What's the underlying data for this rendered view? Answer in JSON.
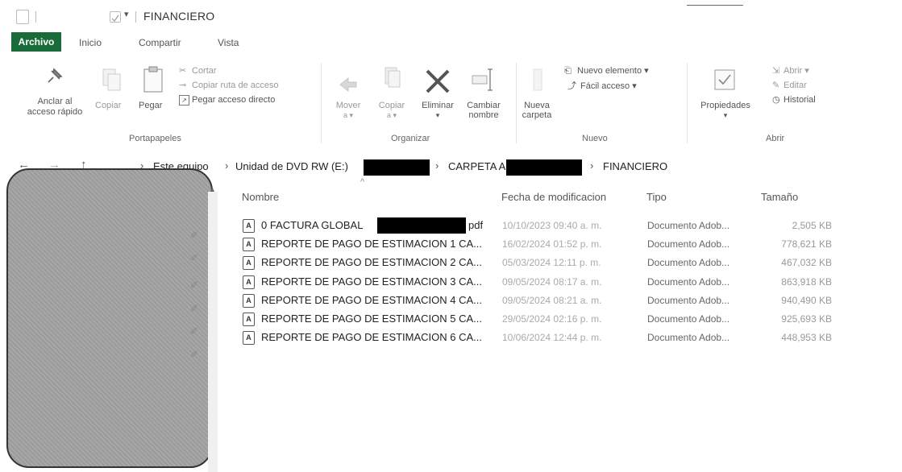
{
  "window": {
    "title": "FINANCIERO"
  },
  "ribbon_tabs": [
    "Archivo",
    "Inicio",
    "Compartir",
    "Vista"
  ],
  "ribbon": {
    "portapapeles": {
      "group_label": "Portapapeles",
      "pin_label_1": "Anclar al",
      "pin_label_2": "acceso rápido",
      "copy": "Copiar",
      "paste": "Pegar",
      "cut": "Cortar",
      "copy_path": "Copiar ruta de acceso",
      "paste_shortcut": "Pegar acceso directo"
    },
    "organizar": {
      "group_label": "Organizar",
      "move_1": "Mover",
      "move_2": "a ▾",
      "copyto_1": "Copiar",
      "copyto_2": "a ▾",
      "delete_1": "Eliminar",
      "delete_2": "▾",
      "rename_1": "Cambiar",
      "rename_2": "nombre"
    },
    "nuevo": {
      "group_label": "Nuevo",
      "new_folder_1": "Nueva",
      "new_folder_2": "carpeta",
      "new_item": "Nuevo elemento ▾",
      "easy_access": "Fácil acceso ▾"
    },
    "abrir": {
      "group_label": "Abrir",
      "properties_1": "Propiedades",
      "properties_2": "▾",
      "open": "Abrir ▾",
      "edit": "Editar",
      "history": "Historial"
    }
  },
  "address": {
    "crumbs": [
      "Este equipo",
      "Unidad de DVD RW (E:)",
      "CARPETA A",
      "FINANCIERO"
    ]
  },
  "columns": {
    "name": "Nombre",
    "date": "Fecha de modificacion",
    "type": "Tipo",
    "size": "Tamaño"
  },
  "files": [
    {
      "name": "0 FACTURA GLOBAL",
      "suffix": "pdf",
      "date": "10/10/2023 09:40 a. m.",
      "type": "Documento Adob...",
      "size": "2,505 KB"
    },
    {
      "name": "REPORTE DE PAGO DE ESTIMACION 1 CA...",
      "date": "16/02/2024 01:52 p. m.",
      "type": "Documento Adob...",
      "size": "778,621 KB"
    },
    {
      "name": "REPORTE DE PAGO DE ESTIMACION 2 CA...",
      "date": "05/03/2024 12:11 p. m.",
      "type": "Documento Adob...",
      "size": "467,032 KB"
    },
    {
      "name": "REPORTE DE PAGO DE ESTIMACION 3 CA...",
      "date": "09/05/2024 08:17 a. m.",
      "type": "Documento Adob...",
      "size": "863,918 KB"
    },
    {
      "name": "REPORTE DE PAGO DE ESTIMACION 4 CA...",
      "date": "09/05/2024 08:21 a. m.",
      "type": "Documento Adob...",
      "size": "940,490 KB"
    },
    {
      "name": "REPORTE DE PAGO DE ESTIMACION 5 CA...",
      "date": "29/05/2024 02:16 p. m.",
      "type": "Documento Adob...",
      "size": "925,693 KB"
    },
    {
      "name": "REPORTE DE PAGO DE ESTIMACION 6 CA...",
      "date": "10/06/2024 12:44 p. m.",
      "type": "Documento Adob...",
      "size": "448,953 KB"
    }
  ],
  "colors": {
    "archivo_tab": "#1a6b3a",
    "delete_x": "#555555"
  }
}
